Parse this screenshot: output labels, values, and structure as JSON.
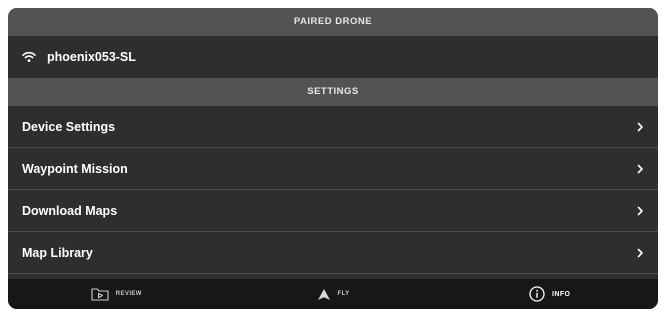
{
  "paired_drone": {
    "header": "PAIRED DRONE",
    "drone_name": "phoenix053-SL",
    "icon": "wifi-icon"
  },
  "settings": {
    "header": "SETTINGS",
    "items": [
      {
        "label": "Device Settings",
        "icon": "chevron-right-icon"
      },
      {
        "label": "Waypoint Mission",
        "icon": "chevron-right-icon"
      },
      {
        "label": "Download Maps",
        "icon": "chevron-right-icon"
      },
      {
        "label": "Map Library",
        "icon": "chevron-right-icon"
      }
    ]
  },
  "tabbar": {
    "tabs": [
      {
        "label": "REVIEW",
        "icon": "review-folder-play-icon",
        "active": false
      },
      {
        "label": "FLY",
        "icon": "fly-arrow-icon",
        "active": false
      },
      {
        "label": "INFO",
        "icon": "info-circle-icon",
        "active": true
      }
    ]
  },
  "colors": {
    "panel_bg": "#2e2e2e",
    "header_bg": "#535353",
    "tabbar_bg": "#171717",
    "divider": "#4d4d4d",
    "text": "#ffffff"
  }
}
